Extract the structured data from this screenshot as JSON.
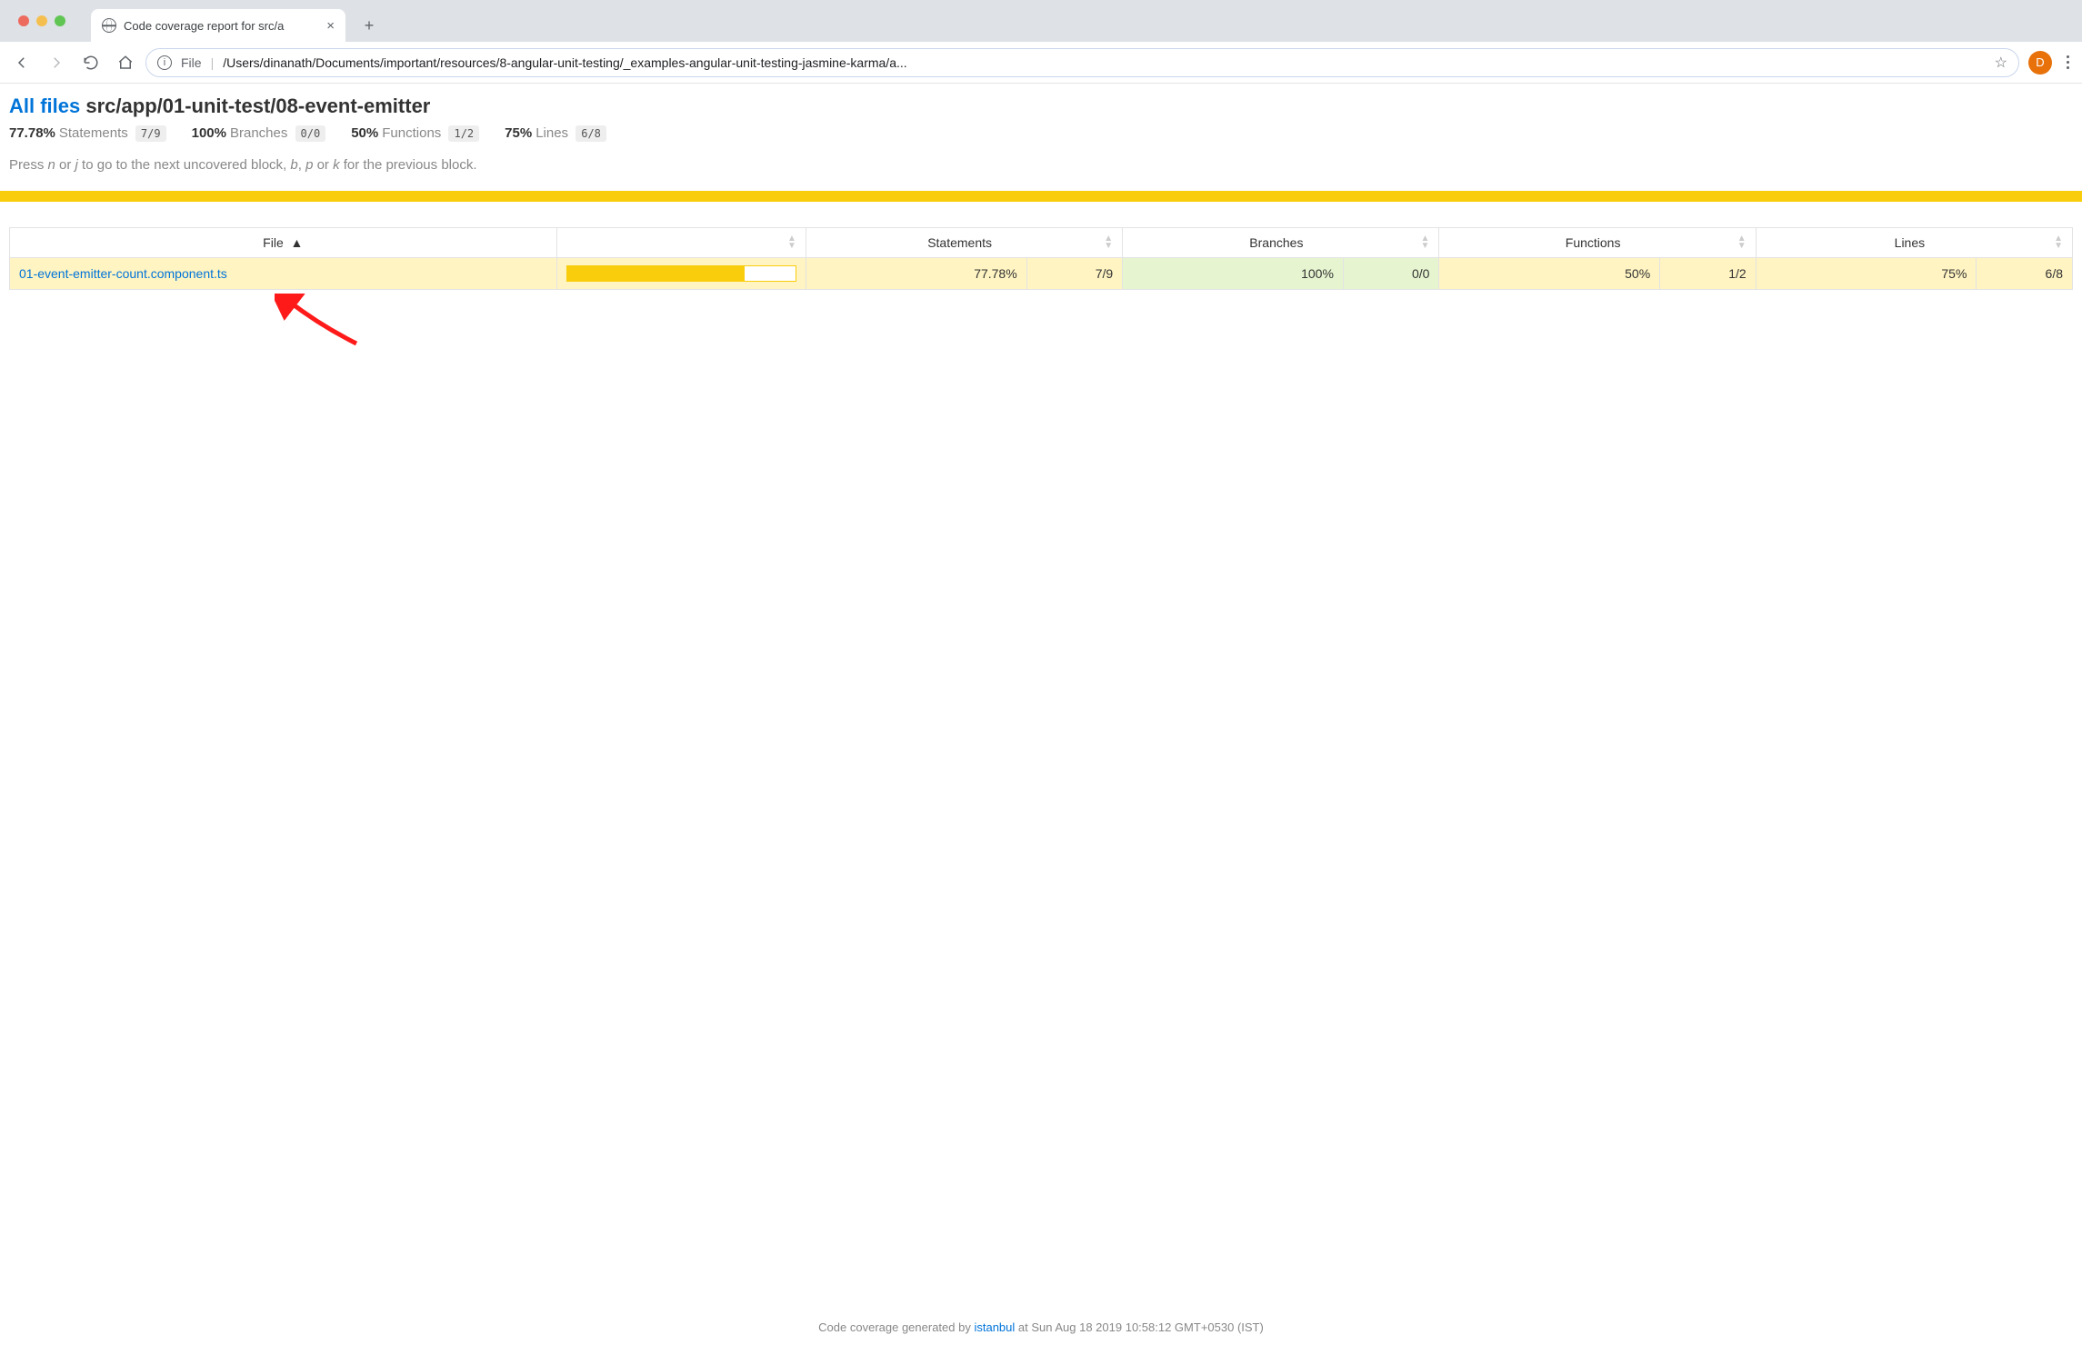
{
  "browser": {
    "tab_title": "Code coverage report for src/a",
    "url_file_label": "File",
    "url_path": "/Users/dinanath/Documents/important/resources/8-angular-unit-testing/_examples-angular-unit-testing-jasmine-karma/a...",
    "avatar_initial": "D"
  },
  "header": {
    "all_files_label": "All files",
    "breadcrumb": "src/app/01-unit-test/08-event-emitter"
  },
  "summary": {
    "statements": {
      "pct": "77.78%",
      "label": "Statements",
      "fraction": "7/9"
    },
    "branches": {
      "pct": "100%",
      "label": "Branches",
      "fraction": "0/0"
    },
    "functions": {
      "pct": "50%",
      "label": "Functions",
      "fraction": "1/2"
    },
    "lines": {
      "pct": "75%",
      "label": "Lines",
      "fraction": "6/8"
    }
  },
  "hint": {
    "prefix": "Press ",
    "k1": "n",
    "or1": " or ",
    "k2": "j",
    "mid": " to go to the next uncovered block, ",
    "k3": "b",
    "c1": ", ",
    "k4": "p",
    "or2": " or ",
    "k5": "k",
    "suffix": " for the previous block."
  },
  "columns": {
    "file": "File",
    "statements": "Statements",
    "branches": "Branches",
    "functions": "Functions",
    "lines": "Lines"
  },
  "rows": [
    {
      "file": "01-event-emitter-count.component.ts",
      "bar_pct": 77.78,
      "statements_pct": "77.78%",
      "statements_frac": "7/9",
      "branches_pct": "100%",
      "branches_frac": "0/0",
      "functions_pct": "50%",
      "functions_frac": "1/2",
      "lines_pct": "75%",
      "lines_frac": "6/8",
      "branches_high": true
    }
  ],
  "footer": {
    "prefix": "Code coverage generated by ",
    "tool": "istanbul",
    "timestamp": " at Sun Aug 18 2019 10:58:12 GMT+0530 (IST)"
  }
}
